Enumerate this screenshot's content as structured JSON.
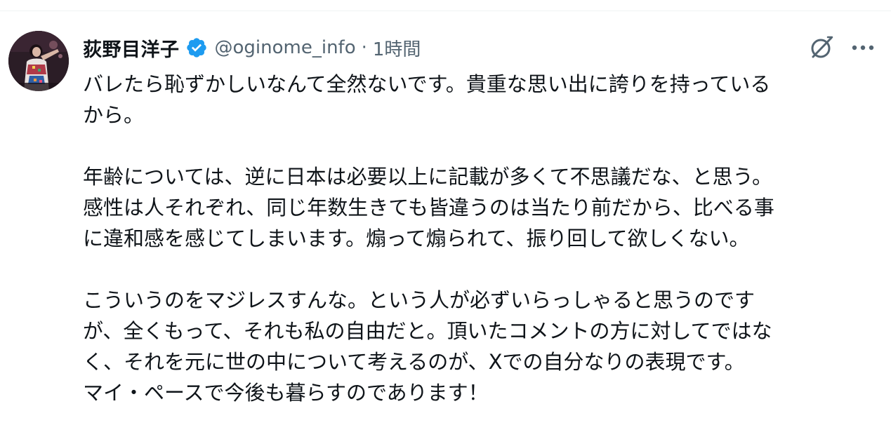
{
  "post": {
    "author": {
      "display_name": "荻野目洋子",
      "handle": "@oginome_info",
      "separator": "·",
      "timestamp": "1時間",
      "verified_icon": "verified-badge-icon",
      "verified_color": "#1d9bf0"
    },
    "actions": {
      "grok_icon": "grok-icon",
      "more_icon": "more-dots-icon"
    },
    "body": {
      "paragraph_1": [
        "バレたら恥ずかしいなんて全然ないです。貴重な思い出に誇りを持っている",
        "から。"
      ],
      "paragraph_2": [
        "年齢については、逆に日本は必要以上に記載が多くて不思議だな、と思う。",
        "感性は人それぞれ、同じ年数生きても皆違うのは当たり前だから、比べる事",
        "に違和感を感じてしまいます。煽って煽られて、振り回して欲しくない。"
      ],
      "paragraph_3": [
        "こういうのをマジレスすんな。という人が必ずいらっしゃると思うのです",
        "が、全くもって、それも私の自由だと。頂いたコメントの方に対してではな",
        "く、それを元に世の中について考えるのが、Xでの自分なりの表現です。",
        "マイ・ペースで今後も暮らすのであります！"
      ]
    }
  },
  "colors": {
    "text_primary": "#0f1419",
    "text_secondary": "#536471",
    "divider": "#eff3f4",
    "accent": "#1d9bf0"
  }
}
